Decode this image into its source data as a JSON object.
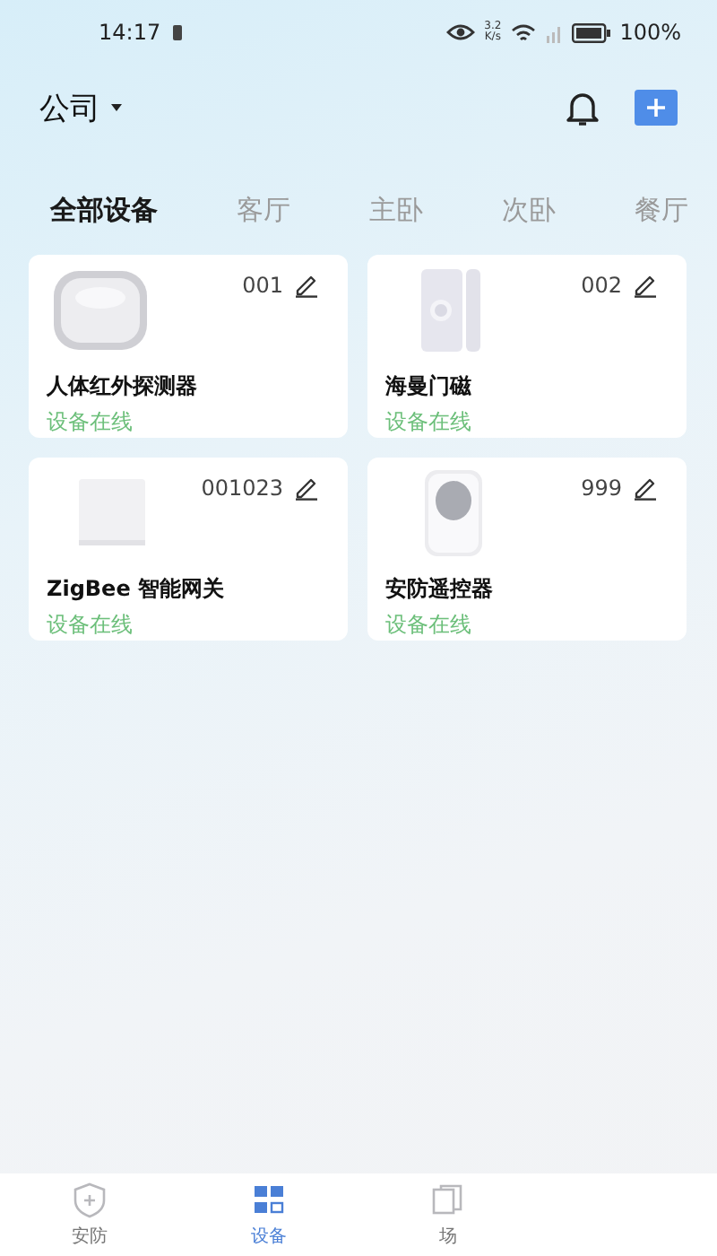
{
  "status_bar": {
    "time": "14:17",
    "speed": "3.2\nK/s",
    "battery": "100%"
  },
  "header": {
    "home": "公司"
  },
  "tabs": [
    {
      "label": "全部设备",
      "selected": true
    },
    {
      "label": "客厅",
      "selected": false
    },
    {
      "label": "主卧",
      "selected": false
    },
    {
      "label": "次卧",
      "selected": false
    },
    {
      "label": "餐厅",
      "selected": false
    }
  ],
  "devices": [
    {
      "name": "人体红外探测器",
      "number": "001",
      "status": "设备在线",
      "kind": "sensor"
    },
    {
      "name": "海曼门磁",
      "number": "002",
      "status": "设备在线",
      "kind": "door"
    },
    {
      "name": "ZigBee 智能网关",
      "number": "001023",
      "status": "设备在线",
      "kind": "gateway"
    },
    {
      "name": "安防遥控器",
      "number": "999",
      "status": "设备在线",
      "kind": "remote"
    }
  ],
  "nav": [
    {
      "label": "安防",
      "selected": false,
      "kind": "shield"
    },
    {
      "label": "设备",
      "selected": true,
      "kind": "grid"
    },
    {
      "label": "场",
      "selected": false,
      "kind": "scene"
    }
  ]
}
